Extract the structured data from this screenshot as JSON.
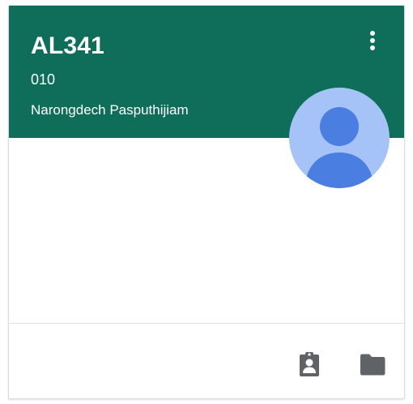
{
  "class_card": {
    "title": "AL341",
    "section": "010",
    "teacher": "Narongdech Pasputhijiam",
    "header_color": "#0f6e5a",
    "avatar_color": "#a6c3f7",
    "avatar_figure_color": "#4a7ee0"
  },
  "icons": {
    "more": "more-vert-icon",
    "avatar": "person-icon",
    "your_work": "assignment-ind-icon",
    "folder": "folder-icon"
  }
}
